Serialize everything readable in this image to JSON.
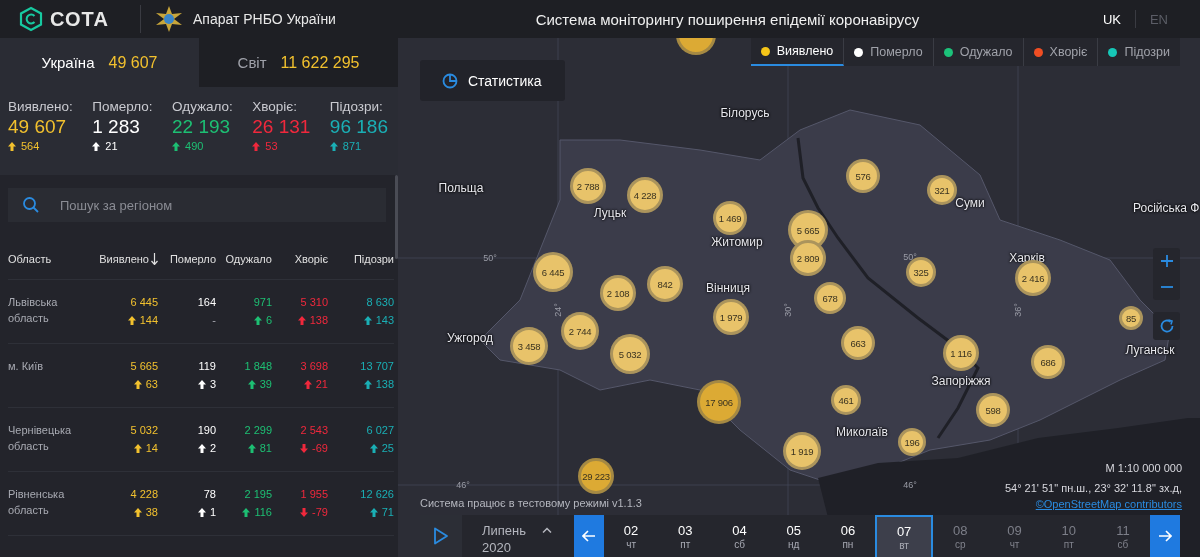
{
  "header": {
    "logo_text": "СОТА",
    "organization": "Апарат РНБО України",
    "title": "Система моніторингу поширення епідемії коронавірусу",
    "languages": [
      {
        "label": "UK",
        "selected": true
      },
      {
        "label": "EN",
        "selected": false
      }
    ]
  },
  "scope_tabs": [
    {
      "label": "Україна",
      "value": "49 607",
      "selected": true
    },
    {
      "label": "Світ",
      "value": "11 622 295",
      "selected": false
    }
  ],
  "totals": [
    {
      "label": "Виявлено:",
      "value": "49 607",
      "delta": "564",
      "kind": "up",
      "color": "#f2c12e"
    },
    {
      "label": "Померло:",
      "value": "1 283",
      "delta": "21",
      "kind": "up",
      "color": "#ffffff"
    },
    {
      "label": "Одужало:",
      "value": "22 193",
      "delta": "490",
      "kind": "up",
      "color": "#1dbf73"
    },
    {
      "label": "Хворіє:",
      "value": "26 131",
      "delta": "53",
      "kind": "up",
      "color": "#f0283c"
    },
    {
      "label": "Підозри:",
      "value": "96 186",
      "delta": "871",
      "kind": "up",
      "color": "#1aafb5"
    }
  ],
  "search": {
    "placeholder": "Пошук за регіоном"
  },
  "table": {
    "columns": [
      {
        "label": "Область",
        "sorted": false
      },
      {
        "label": "Виявлено",
        "sorted": true
      },
      {
        "label": "Померло",
        "sorted": false
      },
      {
        "label": "Одужало",
        "sorted": false
      },
      {
        "label": "Хворіє",
        "sorted": false
      },
      {
        "label": "Підозри",
        "sorted": false
      }
    ],
    "rows": [
      {
        "cells": [
          {
            "value": "Львівська область",
            "kind": "name"
          },
          {
            "value": "6 445",
            "delta": "144",
            "kind": "up"
          },
          {
            "value": "164",
            "delta": "-",
            "kind": "none"
          },
          {
            "value": "971",
            "delta": "6",
            "kind": "up"
          },
          {
            "value": "5 310",
            "delta": "138",
            "kind": "up"
          },
          {
            "value": "8 630",
            "delta": "143",
            "kind": "up"
          }
        ]
      },
      {
        "cells": [
          {
            "value": "м. Київ",
            "kind": "name"
          },
          {
            "value": "5 665",
            "delta": "63",
            "kind": "up"
          },
          {
            "value": "119",
            "delta": "3",
            "kind": "up"
          },
          {
            "value": "1 848",
            "delta": "39",
            "kind": "up"
          },
          {
            "value": "3 698",
            "delta": "21",
            "kind": "up"
          },
          {
            "value": "13 707",
            "delta": "138",
            "kind": "up"
          }
        ]
      },
      {
        "cells": [
          {
            "value": "Чернівецька область",
            "kind": "name"
          },
          {
            "value": "5 032",
            "delta": "14",
            "kind": "up"
          },
          {
            "value": "190",
            "delta": "2",
            "kind": "up"
          },
          {
            "value": "2 299",
            "delta": "81",
            "kind": "up"
          },
          {
            "value": "2 543",
            "delta": "-69",
            "kind": "down"
          },
          {
            "value": "6 027",
            "delta": "25",
            "kind": "up"
          }
        ]
      },
      {
        "cells": [
          {
            "value": "Рівненська область",
            "kind": "name"
          },
          {
            "value": "4 228",
            "delta": "38",
            "kind": "up"
          },
          {
            "value": "78",
            "delta": "1",
            "kind": "up"
          },
          {
            "value": "2 195",
            "delta": "116",
            "kind": "up"
          },
          {
            "value": "1 955",
            "delta": "-79",
            "kind": "down"
          },
          {
            "value": "12 626",
            "delta": "71",
            "kind": "up"
          }
        ]
      }
    ]
  },
  "map": {
    "stats_button": "Статистика",
    "legend": [
      {
        "label": "Виявлено",
        "color": "#f5c518",
        "selected": true
      },
      {
        "label": "Померло",
        "color": "#ffffff",
        "selected": false
      },
      {
        "label": "Одужало",
        "color": "#1cc27a",
        "selected": false
      },
      {
        "label": "Хворіє",
        "color": "#f04e23",
        "selected": false
      },
      {
        "label": "Підозри",
        "color": "#16c7b7",
        "selected": false
      }
    ],
    "place_labels": [
      "Білорусь",
      "Польща",
      "Луцьк",
      "Житомир",
      "Суми",
      "Російська Ф",
      "Харків",
      "Вінниця",
      "Ужгород",
      "Луганськ",
      "Запоріжжя",
      "Миколаїв"
    ],
    "grid_labels": [
      "50°",
      "24°",
      "30°",
      "50°",
      "36°",
      "46°",
      "46°"
    ],
    "bubbles": [
      "2 788",
      "4 228",
      "1 469",
      "5 665",
      "2 809",
      "576",
      "321",
      "6 445",
      "2 108",
      "842",
      "678",
      "325",
      "2 416",
      "85",
      "2 744",
      "3 458",
      "5 032",
      "1 979",
      "663",
      "1 116",
      "686",
      "17 906",
      "461",
      "598",
      "196",
      "1 919",
      "29 223"
    ],
    "scale": "М 1:10 000 000",
    "coordinates": "54° 21' 51\" пн.ш., 23° 32' 11.8\" зх.д,",
    "attribution": "©OpenStreetMap contributors",
    "notice": "Система працює в тестовому режимі v1.1.3"
  },
  "timeline": {
    "month": "Липень",
    "year": "2020",
    "days": [
      {
        "day": "02",
        "weekday": "чт",
        "selected": false,
        "disabled": false
      },
      {
        "day": "03",
        "weekday": "пт",
        "selected": false,
        "disabled": false
      },
      {
        "day": "04",
        "weekday": "сб",
        "selected": false,
        "disabled": false
      },
      {
        "day": "05",
        "weekday": "нд",
        "selected": false,
        "disabled": false
      },
      {
        "day": "06",
        "weekday": "пн",
        "selected": false,
        "disabled": false
      },
      {
        "day": "07",
        "weekday": "вт",
        "selected": true,
        "disabled": false
      },
      {
        "day": "08",
        "weekday": "ср",
        "selected": false,
        "disabled": true
      },
      {
        "day": "09",
        "weekday": "чт",
        "selected": false,
        "disabled": true
      },
      {
        "day": "10",
        "weekday": "пт",
        "selected": false,
        "disabled": true
      },
      {
        "day": "11",
        "weekday": "сб",
        "selected": false,
        "disabled": true
      }
    ]
  }
}
